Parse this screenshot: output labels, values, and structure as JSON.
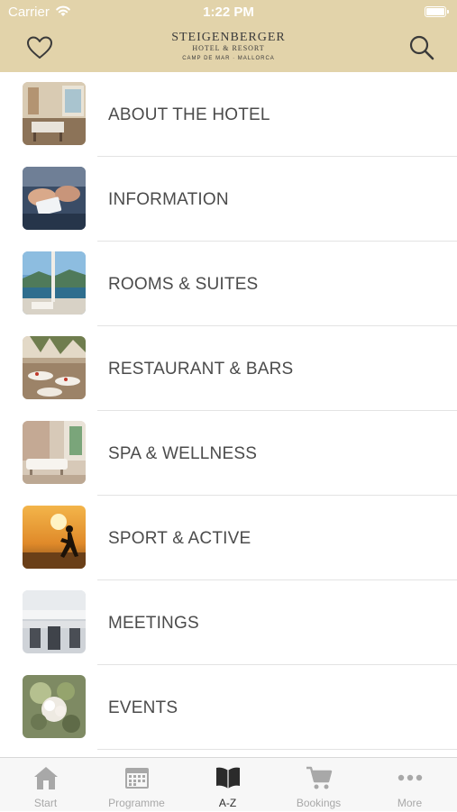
{
  "status_bar": {
    "carrier": "Carrier",
    "time": "1:22 PM"
  },
  "header": {
    "logo_name": "STEIGENBERGER",
    "logo_subtitle": "HOTEL & RESORT",
    "logo_location": "CAMP DE MAR · MALLORCA",
    "favorites_icon": "heart-icon",
    "search_icon": "search-icon"
  },
  "menu": {
    "items": [
      {
        "label": "ABOUT THE HOTEL"
      },
      {
        "label": "INFORMATION"
      },
      {
        "label": "ROOMS & SUITES"
      },
      {
        "label": "RESTAURANT & BARS"
      },
      {
        "label": "SPA & WELLNESS"
      },
      {
        "label": "SPORT & ACTIVE"
      },
      {
        "label": "MEETINGS"
      },
      {
        "label": "EVENTS"
      }
    ]
  },
  "tab_bar": {
    "tabs": [
      {
        "label": "Start",
        "icon": "home-icon"
      },
      {
        "label": "Programme",
        "icon": "calendar-icon"
      },
      {
        "label": "A-Z",
        "icon": "book-icon"
      },
      {
        "label": "Bookings",
        "icon": "cart-icon"
      },
      {
        "label": "More",
        "icon": "more-icon"
      }
    ],
    "active": "A-Z"
  },
  "colors": {
    "header_bg": "#e2d3aa",
    "tab_active": "#2b2b2b",
    "tab_inactive": "#a8a8a8",
    "row_text": "#4b4b4b"
  }
}
